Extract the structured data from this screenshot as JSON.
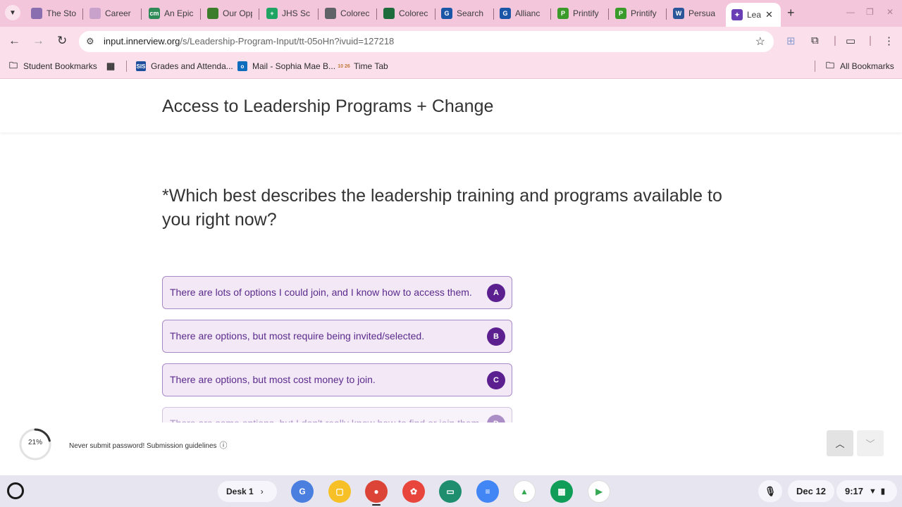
{
  "tabs": [
    {
      "title": "The Sto",
      "fav_color": "#8a6fb0",
      "fav_text": ""
    },
    {
      "title": "Career I",
      "fav_color": "#c9a2cc",
      "fav_text": ""
    },
    {
      "title": "An Epic",
      "fav_color": "#2e8b57",
      "fav_text": "cm"
    },
    {
      "title": "Our Opp",
      "fav_color": "#3b7d2b",
      "fav_text": ""
    },
    {
      "title": "JHS Sc",
      "fav_color": "#1fa463",
      "fav_text": "+"
    },
    {
      "title": "Colorec",
      "fav_color": "#5f6368",
      "fav_text": ""
    },
    {
      "title": "Colorec",
      "fav_color": "#1e6b3c",
      "fav_text": ""
    },
    {
      "title": "Search",
      "fav_color": "#1a56a8",
      "fav_text": "G"
    },
    {
      "title": "Allianc",
      "fav_color": "#1a56a8",
      "fav_text": "G"
    },
    {
      "title": "Printify",
      "fav_color": "#3a9a2a",
      "fav_text": "P"
    },
    {
      "title": "Printify",
      "fav_color": "#3a9a2a",
      "fav_text": "P"
    },
    {
      "title": "Persua",
      "fav_color": "#2b579a",
      "fav_text": "W"
    }
  ],
  "active_tab": {
    "title": "Lea",
    "close": "✕"
  },
  "new_tab": "+",
  "address_bar": {
    "host": "input.innerview.org",
    "path": "/s/Leadership-Program-Input/tt-05oHn?ivuid=127218"
  },
  "bookmarks": [
    {
      "label": "Student Bookmarks",
      "icon": "folder-icon"
    },
    {
      "label": "",
      "icon": "apps-grid-icon"
    },
    {
      "label": "Grades and Attenda...",
      "icon": "sis-icon",
      "icon_text": "SIS"
    },
    {
      "label": "Mail - Sophia Mae B...",
      "icon": "outlook-icon",
      "icon_text": "o"
    },
    {
      "label": "Time Tab",
      "icon": "time-tab-icon",
      "icon_text": "10 26"
    }
  ],
  "all_bookmarks": "All Bookmarks",
  "survey": {
    "header_title": "Access to Leadership Programs + Change",
    "question": "*Which best describes the leadership training and programs available to you right now?",
    "options": [
      {
        "key": "A",
        "text": "There are lots of options I could join, and I know how to access them."
      },
      {
        "key": "B",
        "text": "There are options, but most require being invited/selected."
      },
      {
        "key": "C",
        "text": "There are options, but most cost money to join."
      },
      {
        "key": "D",
        "text": "There are some options, but I don't really know how to find or join them."
      }
    ],
    "progress_percent": 21,
    "progress_label": "21%",
    "footer_note": "Never submit password! Submission guidelines",
    "accent_color": "#5c1f8f"
  },
  "shelf": {
    "desk_label": "Desk 1",
    "date": "Dec 12",
    "time": "9:17",
    "apps": [
      {
        "name": "google-translate",
        "color": "#4a7fe0",
        "glyph": "G"
      },
      {
        "name": "google-keep",
        "color": "#f6c026",
        "glyph": "▢"
      },
      {
        "name": "chrome",
        "color": "#db4437",
        "glyph": "●"
      },
      {
        "name": "canvas-paint",
        "color": "#e8453c",
        "glyph": "✿"
      },
      {
        "name": "google-classroom",
        "color": "#1e8e6e",
        "glyph": "▭"
      },
      {
        "name": "google-docs",
        "color": "#4285f4",
        "glyph": "≡"
      },
      {
        "name": "google-drive",
        "color": "#ffffff",
        "glyph": "▲"
      },
      {
        "name": "google-sheets",
        "color": "#0f9d58",
        "glyph": "▦"
      },
      {
        "name": "google-play",
        "color": "#ffffff",
        "glyph": "▶"
      }
    ]
  }
}
